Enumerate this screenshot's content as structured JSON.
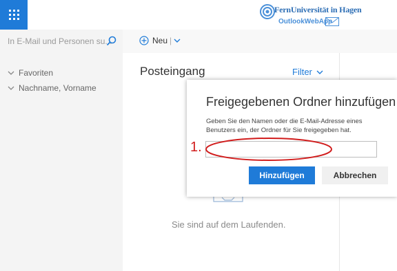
{
  "header": {
    "logo_line1": "FernUniversität in Hagen",
    "logo_line2": "OutlookWebApp",
    "accent_color": "#1f7bd8"
  },
  "search": {
    "placeholder": "In E-Mail und Personen su..."
  },
  "toolbar": {
    "new_label": "Neu"
  },
  "sidebar": {
    "items": [
      {
        "label": "Favoriten"
      },
      {
        "label": "Nachname, Vorname"
      }
    ]
  },
  "message_list": {
    "title": "Posteingang",
    "filter_label": "Filter",
    "empty_text": "Sie sind auf dem Laufenden."
  },
  "dialog": {
    "title": "Freigegebenen Ordner hinzufügen",
    "description": "Geben Sie den Namen oder die E-Mail-Adresse eines Benutzers ein, der Ordner für Sie freigegeben hat.",
    "input_value": "",
    "add_label": "Hinzufügen",
    "cancel_label": "Abbrechen"
  },
  "annotation": {
    "step_label": "1.",
    "color": "#d11c1c"
  }
}
